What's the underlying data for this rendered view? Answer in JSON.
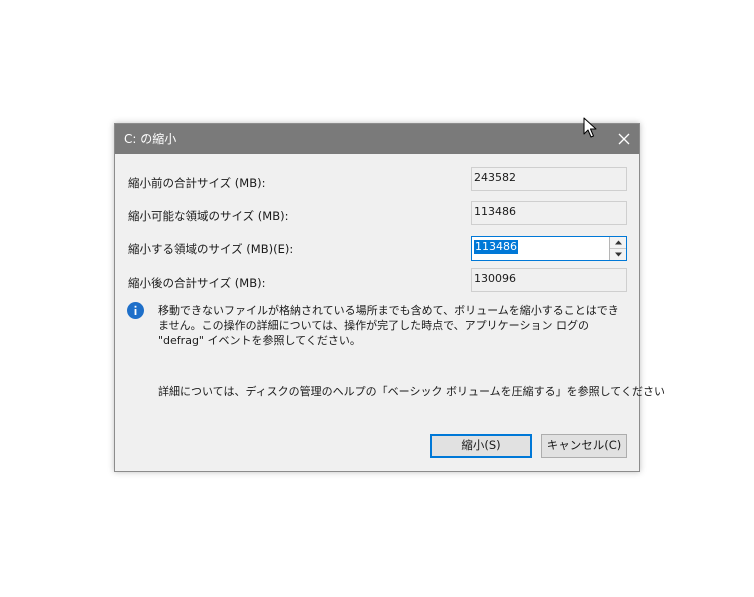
{
  "window": {
    "title": "C: の縮小"
  },
  "fields": [
    {
      "label": "縮小前の合計サイズ (MB):",
      "value": "243582"
    },
    {
      "label": "縮小可能な領域のサイズ (MB):",
      "value": "113486"
    },
    {
      "label": "縮小する領域のサイズ (MB)(E):",
      "value": "113486"
    },
    {
      "label": "縮小後の合計サイズ (MB):",
      "value": "130096"
    }
  ],
  "info": {
    "icon": "info-icon",
    "message": "移動できないファイルが格納されている場所までも含めて、ボリュームを縮小することはできません。この操作の詳細については、操作が完了した時点で、アプリケーション ログの \"defrag\" イベントを参照してください。",
    "help": "詳細については、ディスクの管理のヘルプの「ベーシック ボリュームを圧縮する」を参照してください"
  },
  "buttons": {
    "shrink": "縮小(S)",
    "cancel": "キャンセル(C)"
  },
  "colors": {
    "titlebar": "#7a7a7a",
    "accent": "#0078d7",
    "dialog_bg": "#f0f0f0"
  }
}
